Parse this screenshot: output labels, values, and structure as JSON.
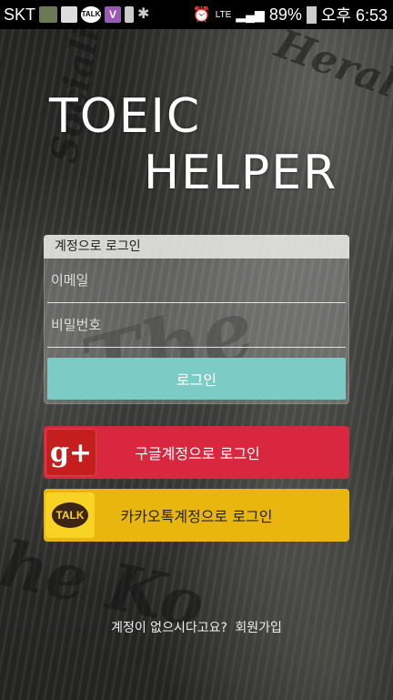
{
  "status_bar": {
    "carrier": "SKT",
    "network": "LTE",
    "battery": "89%",
    "time": "오후 6:53",
    "icons": [
      "thumbnail-icon",
      "image-icon",
      "talk-icon",
      "v-icon",
      "battery-saver-icon",
      "bug-icon",
      "alarm-icon",
      "signal-icon",
      "battery-icon"
    ]
  },
  "title": {
    "line1": "TOEIC",
    "line2": "HELPER"
  },
  "login": {
    "header": "계정으로 로그인",
    "email_placeholder": "이메일",
    "password_placeholder": "비밀번호",
    "submit_label": "로그인"
  },
  "social": {
    "google_label": "구글계정으로 로그인",
    "google_icon_text": "g+",
    "kakao_label": "카카오톡계정으로 로그인",
    "kakao_icon_text": "TALK"
  },
  "signup": {
    "question": "계정이 없으시다고요?",
    "link": "회원가입"
  },
  "colors": {
    "login_button": "#7ccbc4",
    "google": "#d9273f",
    "kakao": "#e9b50f"
  }
}
